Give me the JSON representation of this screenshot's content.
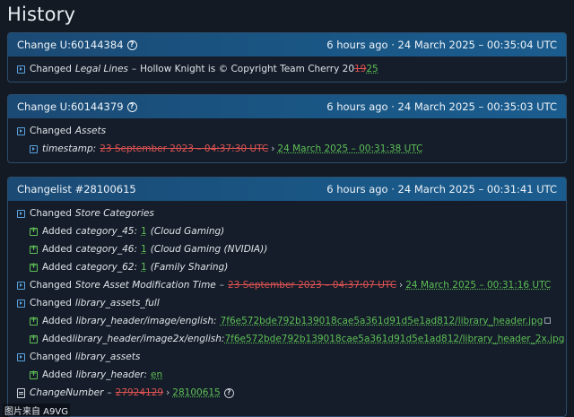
{
  "page_title": "History",
  "card1": {
    "title": "Change U:60144384",
    "time": "6 hours ago · 24 March 2025 – 00:35:04 UTC",
    "row": {
      "changed": "Changed",
      "field": "Legal Lines",
      "dash": "–",
      "value_prefix": "Hollow Knight is © Copyright Team Cherry 20",
      "old": "19",
      "new": "25"
    }
  },
  "card2": {
    "title": "Change U:60144379",
    "time": "6 hours ago · 24 March 2025 – 00:35:03 UTC",
    "row1": {
      "changed": "Changed",
      "field": "Assets"
    },
    "row2": {
      "field": "timestamp:",
      "old": "23 September 2023 – 04:37:30 UTC",
      "arrow": "›",
      "new": "24 March 2025 – 00:31:38 UTC"
    }
  },
  "card3": {
    "title": "Changelist #28100615",
    "time": "6 hours ago · 24 March 2025 – 00:31:41 UTC",
    "store_categories": {
      "changed": "Changed",
      "field": "Store Categories"
    },
    "added_items": [
      {
        "added": "Added",
        "key": "category_45:",
        "val": "1",
        "note": "(Cloud Gaming)"
      },
      {
        "added": "Added",
        "key": "category_46:",
        "val": "1",
        "note": "(Cloud Gaming (NVIDIA))"
      },
      {
        "added": "Added",
        "key": "category_62:",
        "val": "1",
        "note": "(Family Sharing)"
      }
    ],
    "mod_time": {
      "changed": "Changed",
      "field": "Store Asset Modification Time",
      "dash": "–",
      "old": "23 September 2023 – 04:37:07 UTC",
      "arrow": "›",
      "new": "24 March 2025 – 00:31:16 UTC"
    },
    "assets_full": {
      "changed": "Changed",
      "field": "library_assets_full"
    },
    "assets_full_items": [
      {
        "added": "Added",
        "key": "library_header/image/english:",
        "val": "7f6e572bde792b139018cae5a361d91d5e1ad812/library_header.jpg"
      },
      {
        "added": "Added",
        "key": "library_header/image2x/english:",
        "val": "7f6e572bde792b139018cae5a361d91d5e1ad812/library_header_2x.jpg"
      }
    ],
    "assets": {
      "changed": "Changed",
      "field": "library_assets"
    },
    "assets_item": {
      "added": "Added",
      "key": "library_header:",
      "val": "en"
    },
    "change_number": {
      "field": "ChangeNumber",
      "dash": "–",
      "old": "27924129",
      "arrow": "›",
      "new": "28100615"
    }
  },
  "watermark": "图片来自 A9VG"
}
